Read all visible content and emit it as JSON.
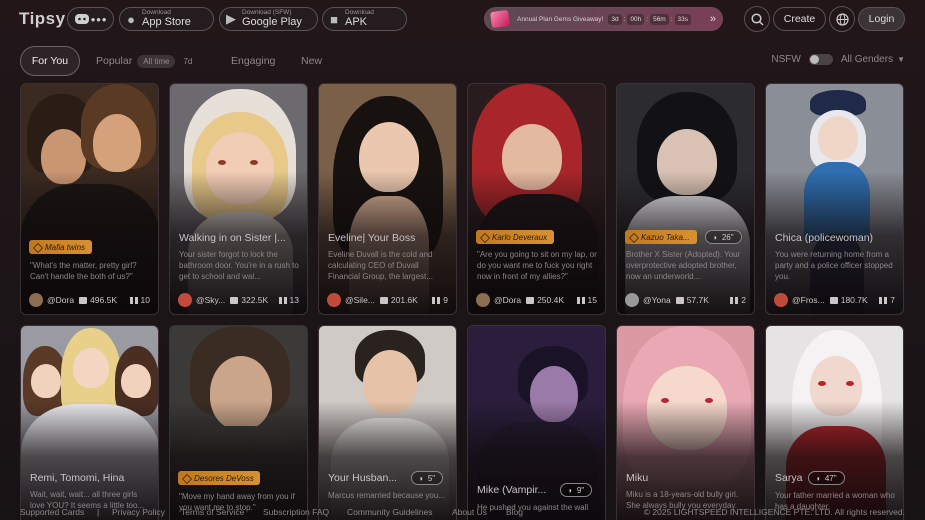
{
  "app": {
    "logo": "Tipsy"
  },
  "downloads": [
    {
      "small": "Download",
      "main": "App Store",
      "icon": "apple-icon"
    },
    {
      "small": "Download (SFW)",
      "main": "Google Play",
      "icon": "google-play-icon"
    },
    {
      "small": "Download",
      "main": "APK",
      "icon": "android-icon"
    }
  ],
  "promo": {
    "text": "Annual Plan Gems Giveaway!",
    "days": "3d",
    "hours": "00h",
    "minutes": "56m",
    "seconds": "33s"
  },
  "header": {
    "create": "Create",
    "login": "Login"
  },
  "tabs": {
    "for_you": "For You",
    "popular": "Popular",
    "all_time": "All time",
    "seven_d": "7d",
    "engaging": "Engaging",
    "new": "New",
    "nsfw": "NSFW",
    "gender": "All Genders"
  },
  "colors": {
    "accent_tag": "#d08a2a",
    "background": "#1c1518"
  },
  "cards": [
    {
      "title": "",
      "tag": "Mafia twins",
      "desc": "\"What's the matter, pretty girl? Can't handle the both of us?\"",
      "author": "@Dora",
      "chats": "496.5K",
      "books": "10"
    },
    {
      "title": "Walking in on Sister |...",
      "tag": "",
      "desc": "Your sister forgot to lock the bathroom door. You're in a rush to get to school and wal...",
      "author": "@Sky...",
      "chats": "322.5K",
      "books": "13"
    },
    {
      "title": "Eveline| Your Boss",
      "tag": "",
      "desc": "Eveline Duvall is the cold and calculating CEO of Duvall Financial Group, the largest...",
      "author": "@Sile...",
      "chats": "201.6K",
      "books": "9"
    },
    {
      "title": "",
      "tag": "Karlo Deveraux",
      "desc": "\"Are you going to sit on my lap, or do you want me to fuck you right now in front of my allies?\"",
      "author": "@Dora",
      "chats": "250.4K",
      "books": "15"
    },
    {
      "title": "",
      "tag": "Kazuo Taka...",
      "voice": "26\"",
      "desc": "Brother X Sister (Adopted). Your overprotective adopted brother, now an underworld...",
      "author": "@Yona",
      "chats": "57.7K",
      "books": "2"
    },
    {
      "title": "Chica (policewoman)",
      "tag": "",
      "desc": "You were returning home from a party and a police officer stopped you.",
      "author": "@Fros...",
      "chats": "180.7K",
      "books": "7"
    },
    {
      "title": "Remi, Tomomi, Hina",
      "tag": "",
      "desc": "Wait, wait, wait... all three girls love YOU? It seems a little too...",
      "author": "",
      "chats": "",
      "books": ""
    },
    {
      "title": "",
      "tag": "Desores DeVoss",
      "desc": "\"Move my hand away from you if you want me to stop.\"",
      "author": "",
      "chats": "",
      "books": ""
    },
    {
      "title": "Your Husban...",
      "tag": "",
      "voice": "5\"",
      "desc": "Marcus remarried because you...",
      "author": "",
      "chats": "",
      "books": ""
    },
    {
      "title": "Mike (Vampir...",
      "tag": "",
      "voice": "9\"",
      "desc": "He pushed you against the wall",
      "author": "",
      "chats": "",
      "books": ""
    },
    {
      "title": "Miku",
      "tag": "",
      "desc": "Miku is a 18-years-old bully girl. She always bully you everyday.",
      "author": "",
      "chats": "",
      "books": ""
    },
    {
      "title": "Sarya",
      "tag": "",
      "voice": "47\"",
      "desc": "Your father married a woman who has a daughter.",
      "author": "",
      "chats": "",
      "books": ""
    }
  ],
  "footer": {
    "supported_cards": "Supported Cards",
    "privacy": "Privacy Policy",
    "terms": "Terms of Service",
    "subscription": "Subscription FAQ",
    "community": "Community Guidelines",
    "about": "About Us",
    "blog": "Blog",
    "copyright": "© 2025 LIGHTSPEED INTELLIGENCE PTE. LTD. All rights reserved."
  }
}
